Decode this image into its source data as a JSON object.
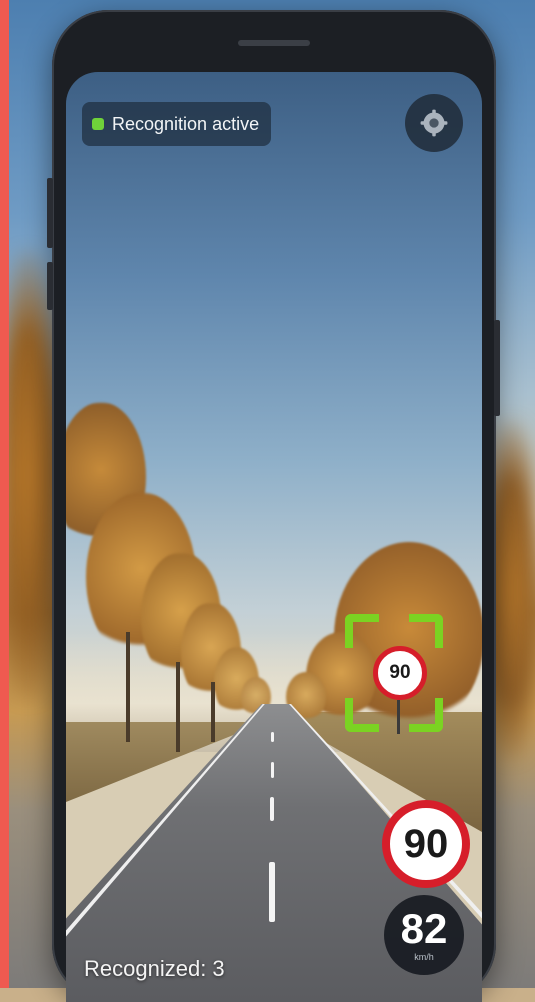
{
  "status": {
    "label": "Recognition active",
    "indicator_color": "#6fd23a"
  },
  "toolbar": {
    "settings_icon": "gear-icon"
  },
  "detection": {
    "small_sign_value": "90",
    "frame_color": "#7bd322"
  },
  "speed_limit": {
    "value": "90",
    "ring_color": "#d61e2a"
  },
  "current_speed": {
    "value": "82",
    "unit": "km/h"
  },
  "footer": {
    "recognized_text": "Recognized: 3"
  }
}
